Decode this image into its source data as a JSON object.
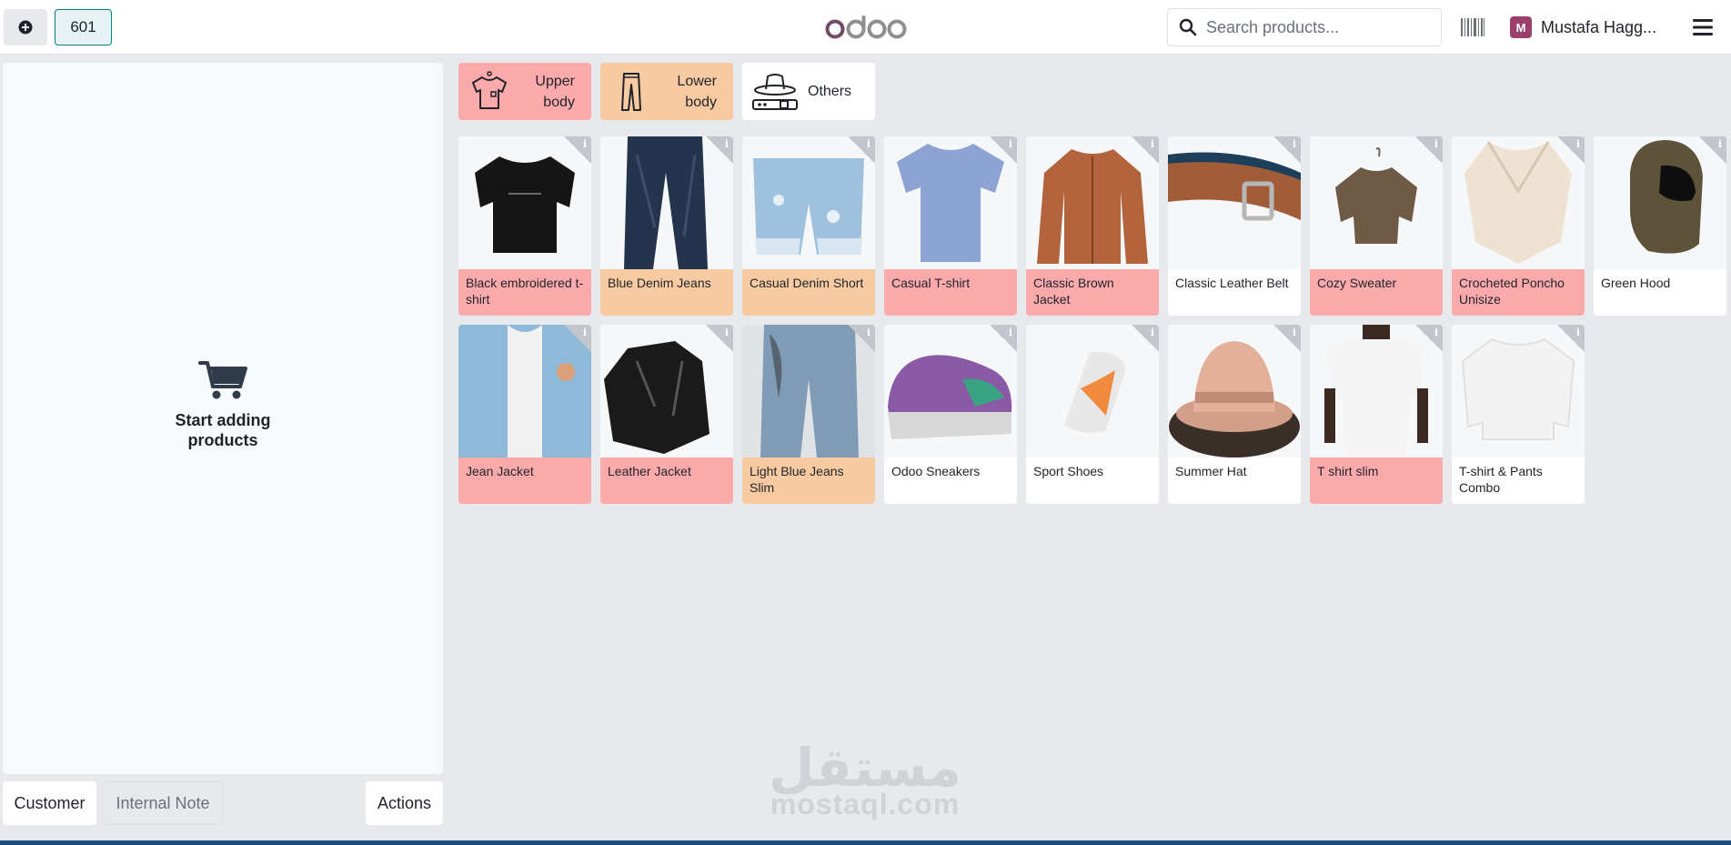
{
  "header": {
    "order_tab": "601",
    "search_placeholder": "Search products...",
    "user_initial": "M",
    "user_name": "Mustafa Hagg...",
    "logo_color": "#714b67"
  },
  "order_panel": {
    "empty_text": "Start adding products",
    "buttons": {
      "customer": "Customer",
      "internal_note": "Internal Note",
      "actions": "Actions"
    }
  },
  "categories": [
    {
      "label": "Upper body",
      "color": "#fbaaac",
      "icon": "tshirt-icon"
    },
    {
      "label": "Lower body",
      "color": "#f7caa1",
      "icon": "pants-icon"
    },
    {
      "label": "Others",
      "color": "#ffffff",
      "icon": "hat-belt-icon"
    }
  ],
  "products": [
    {
      "name": "Black embroidered t-shirt",
      "category": "upper"
    },
    {
      "name": "Blue Denim Jeans",
      "category": "lower"
    },
    {
      "name": "Casual Denim Short",
      "category": "lower"
    },
    {
      "name": "Casual T-shirt",
      "category": "upper"
    },
    {
      "name": "Classic Brown Jacket",
      "category": "upper"
    },
    {
      "name": "Classic Leather Belt",
      "category": "other"
    },
    {
      "name": "Cozy Sweater",
      "category": "upper"
    },
    {
      "name": "Crocheted Poncho Unisize",
      "category": "upper"
    },
    {
      "name": "Green Hood",
      "category": "other"
    },
    {
      "name": "Jean Jacket",
      "category": "upper"
    },
    {
      "name": "Leather Jacket",
      "category": "upper"
    },
    {
      "name": "Light Blue Jeans Slim",
      "category": "lower"
    },
    {
      "name": "Odoo Sneakers",
      "category": "other"
    },
    {
      "name": "Sport Shoes",
      "category": "other"
    },
    {
      "name": "Summer Hat",
      "category": "other"
    },
    {
      "name": "T shirt slim",
      "category": "upper"
    },
    {
      "name": "T-shirt & Pants Combo",
      "category": "other"
    }
  ],
  "watermark": {
    "arabic": "مستقل",
    "latin": "mostaql.com"
  }
}
